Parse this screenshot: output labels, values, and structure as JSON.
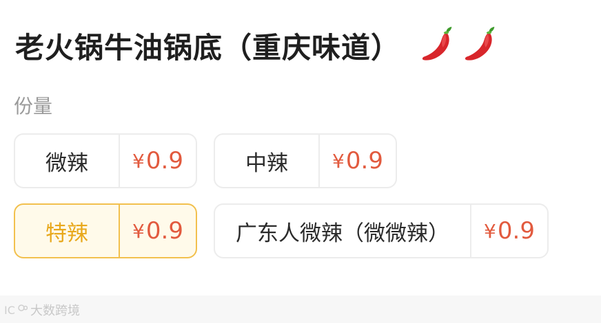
{
  "header": {
    "title": "老火锅牛油锅底（重庆味道）",
    "spice_icons": [
      "chili-pepper-icon",
      "chili-pepper-icon"
    ]
  },
  "portion": {
    "label": "份量",
    "options": [
      {
        "name": "微辣",
        "currency": "¥",
        "price": "0.9",
        "selected": false
      },
      {
        "name": "中辣",
        "currency": "¥",
        "price": "0.9",
        "selected": false
      },
      {
        "name": "特辣",
        "currency": "¥",
        "price": "0.9",
        "selected": true
      },
      {
        "name": "广东人微辣（微微辣）",
        "currency": "¥",
        "price": "0.9",
        "selected": false
      }
    ]
  },
  "watermark": {
    "text": "大数跨境",
    "logo_text": "IC"
  },
  "colors": {
    "price": "#e25a3e",
    "selected_text": "#e8a81c",
    "selected_border": "#f2c04d",
    "selected_bg": "#fffaea",
    "label": "#9a9a9a"
  }
}
